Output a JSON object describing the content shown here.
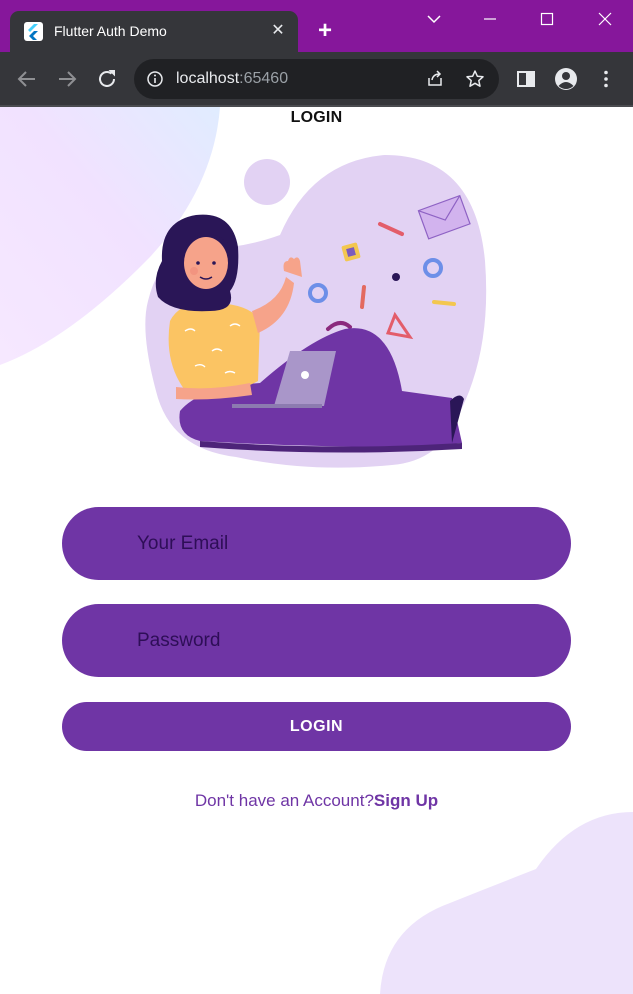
{
  "browser": {
    "tab_title": "Flutter Auth Demo",
    "tab_close_glyph": "✕",
    "new_tab_glyph": "+",
    "url_host": "localhost",
    "url_port": ":65460",
    "colors": {
      "tabbar": "#86179b",
      "toolbar": "#35363a",
      "omnibox": "#202124"
    },
    "icons": [
      "back-icon",
      "forward-icon",
      "reload-icon",
      "site-info-icon",
      "share-icon",
      "star-icon",
      "side-panel-icon",
      "profile-icon",
      "menu-icon",
      "minimize-icon",
      "maximize-icon",
      "close-window-icon",
      "chevron-down-icon",
      "flutter-icon"
    ]
  },
  "app": {
    "title": "LOGIN",
    "email_placeholder": "Your Email",
    "password_placeholder": "Password",
    "login_button": "LOGIN",
    "signup_prompt": "Don't have an Account?",
    "signup_link": "Sign Up",
    "colors": {
      "primary": "#6f35a5",
      "primary_light": "#f1e6ff",
      "placeholder": "#2e0e57"
    }
  }
}
